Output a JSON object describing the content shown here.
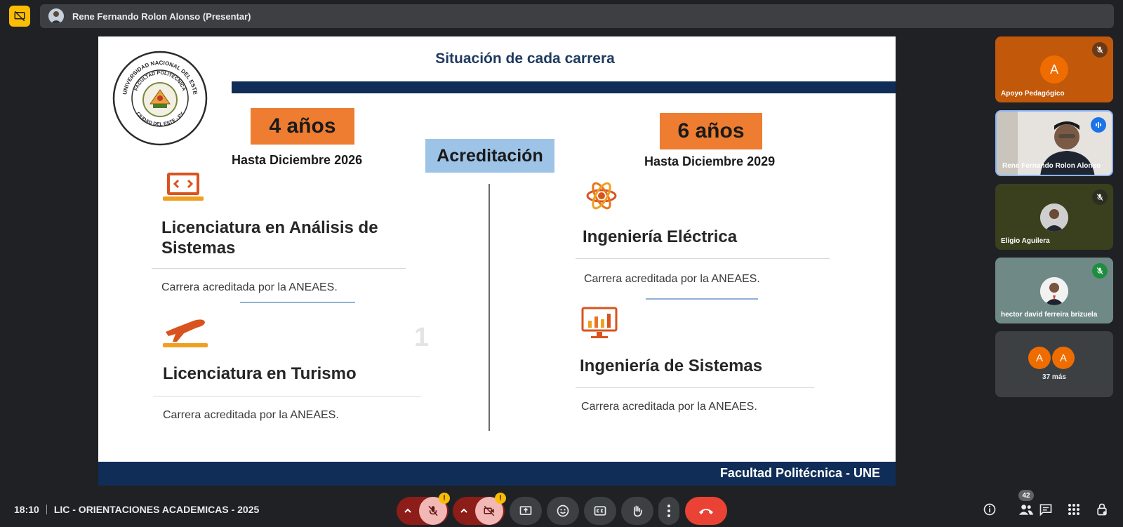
{
  "header": {
    "presenter_name": "Rene Fernando Rolon Alonso (Presentar)"
  },
  "slide": {
    "title": "Situación de cada carrera",
    "acreditacion_label": "Acreditación",
    "left": {
      "years": "4 años",
      "deadline": "Hasta Diciembre 2026",
      "careers": [
        {
          "title": "Licenciatura en Análisis de Sistemas",
          "desc": "Carrera acreditada por la ANEAES."
        },
        {
          "title": "Licenciatura en Turismo",
          "desc": "Carrera acreditada por la ANEAES."
        }
      ]
    },
    "right": {
      "years": "6 años",
      "deadline": "Hasta Diciembre 2029",
      "careers": [
        {
          "title": "Ingeniería Eléctrica",
          "desc": "Carrera acreditada por la ANEAES."
        },
        {
          "title": "Ingeniería de Sistemas",
          "desc": "Carrera acreditada por la ANEAES."
        }
      ]
    },
    "footer": "Facultad Politécnica - UNE",
    "logo_text": {
      "outer_top": "UNIVERSIDAD NACIONAL DEL ESTE",
      "inner_top": "FACULTAD POLITÉCNICA",
      "bottom": "CIUDAD DEL ESTE - PY"
    }
  },
  "participants": [
    {
      "name": "Apoyo Pedagógico",
      "initial": "A",
      "bg": "#c2580a",
      "muted": true
    },
    {
      "name": "Rene Fernando Rolon Alonso",
      "speaking": true
    },
    {
      "name": "Eligio Aguilera",
      "muted": true
    },
    {
      "name": "hector david ferreira brizuela",
      "muted": true
    }
  ],
  "more_participants": {
    "initials": [
      "A",
      "A"
    ],
    "label": "37 más"
  },
  "bottom_bar": {
    "time": "18:10",
    "meeting_title": "LIC - ORIENTACIONES ACADEMICAS - 2025",
    "warning_mark": "!",
    "people_count": "42"
  },
  "colors": {
    "accent_orange": "#ee7d31",
    "navy": "#0f2d57",
    "light_blue": "#9dc3e6",
    "hangup_red": "#ea4335",
    "present_yellow": "#fbbc04"
  }
}
